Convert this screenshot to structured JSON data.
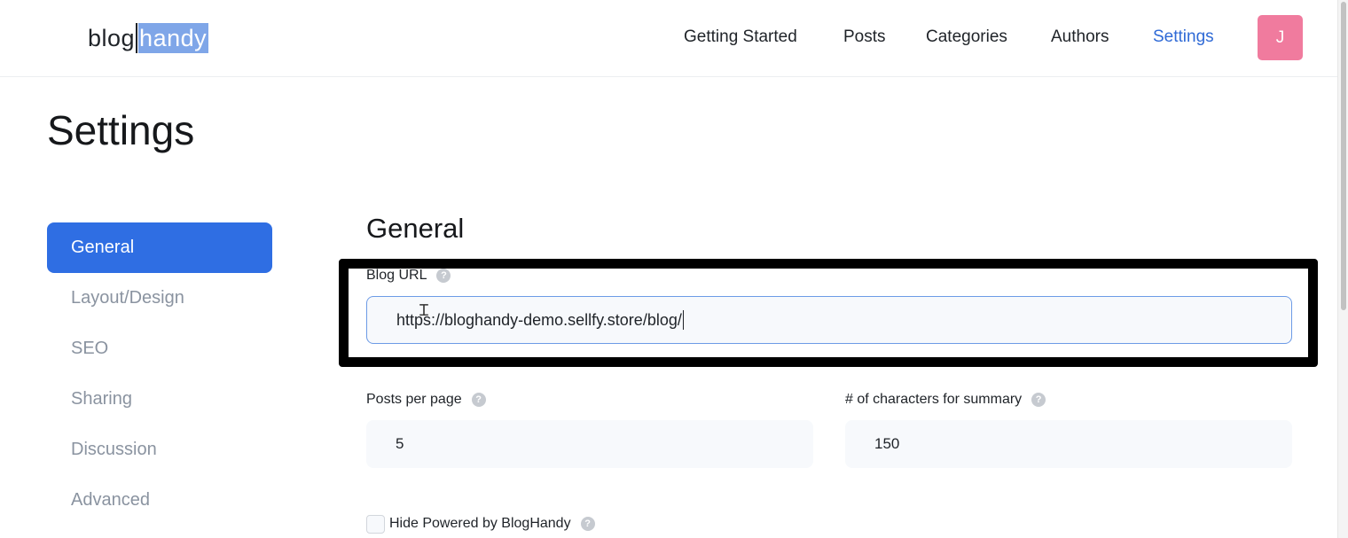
{
  "header": {
    "logo_left": "blog",
    "logo_right": "handy",
    "nav": [
      {
        "label": "Getting Started"
      },
      {
        "label": "Posts"
      },
      {
        "label": "Categories"
      },
      {
        "label": "Authors"
      },
      {
        "label": "Settings",
        "active": true
      }
    ],
    "avatar_initial": "J"
  },
  "page": {
    "title": "Settings"
  },
  "sidebar": {
    "items": [
      {
        "label": "General",
        "active": true
      },
      {
        "label": "Layout/Design"
      },
      {
        "label": "SEO"
      },
      {
        "label": "Sharing"
      },
      {
        "label": "Discussion"
      },
      {
        "label": "Advanced"
      }
    ]
  },
  "general": {
    "title": "General",
    "blog_url": {
      "label": "Blog URL",
      "value": "https://bloghandy-demo.sellfy.store/blog/"
    },
    "posts_per_page": {
      "label": "Posts per page",
      "value": "5"
    },
    "summary_chars": {
      "label": "# of characters for summary",
      "value": "150"
    },
    "hide_powered": {
      "label": "Hide Powered by BlogHandy",
      "checked": false
    },
    "help_glyph": "?"
  },
  "colors": {
    "accent": "#2f6ee3",
    "active_nav": "#2f6ad6",
    "avatar": "#f07b9e",
    "highlight_frame": "#000000"
  }
}
